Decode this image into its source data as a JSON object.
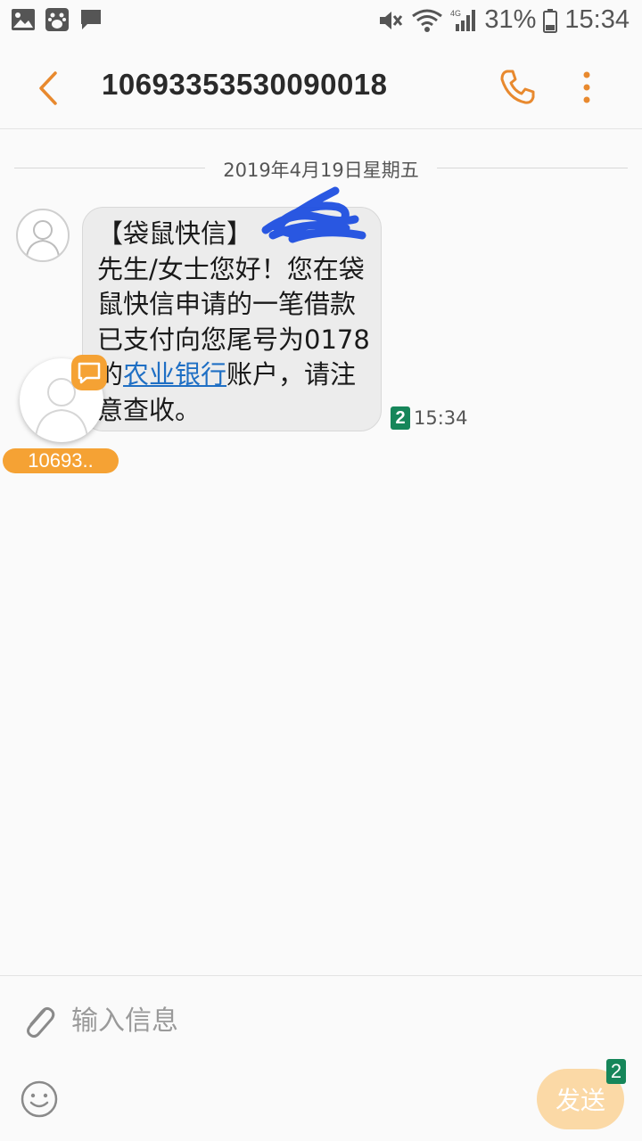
{
  "status_bar": {
    "battery_percent": "31%",
    "time": "15:34",
    "network": "4G",
    "icons": [
      "gallery-icon",
      "baidu-icon",
      "message-notification-icon",
      "mute-icon",
      "wifi-icon",
      "signal-icon",
      "battery-icon"
    ]
  },
  "header": {
    "title": "10693353530090018",
    "back_icon": "chevron-left-icon",
    "call_icon": "phone-icon",
    "more_icon": "more-vert-icon"
  },
  "conversation": {
    "date": "2019年4月19日星期五",
    "messages": [
      {
        "text_before_link": "【袋鼠快信】",
        "text_after_redaction": "先生/女士您好！您在袋鼠快信申请的一笔借款已支付向您尾号为0178的",
        "link_text": "农业银行",
        "text_after_link": "账户，请注意查收。",
        "sim": "2",
        "time": "15:34"
      }
    ]
  },
  "chat_head": {
    "label": "10693.."
  },
  "composer": {
    "placeholder": "输入信息",
    "send_label": "发送",
    "sim": "2"
  },
  "colors": {
    "accent": "#f5a234",
    "sim_badge": "#16865a",
    "link": "#1f6fc4",
    "bubble": "#ececec"
  }
}
